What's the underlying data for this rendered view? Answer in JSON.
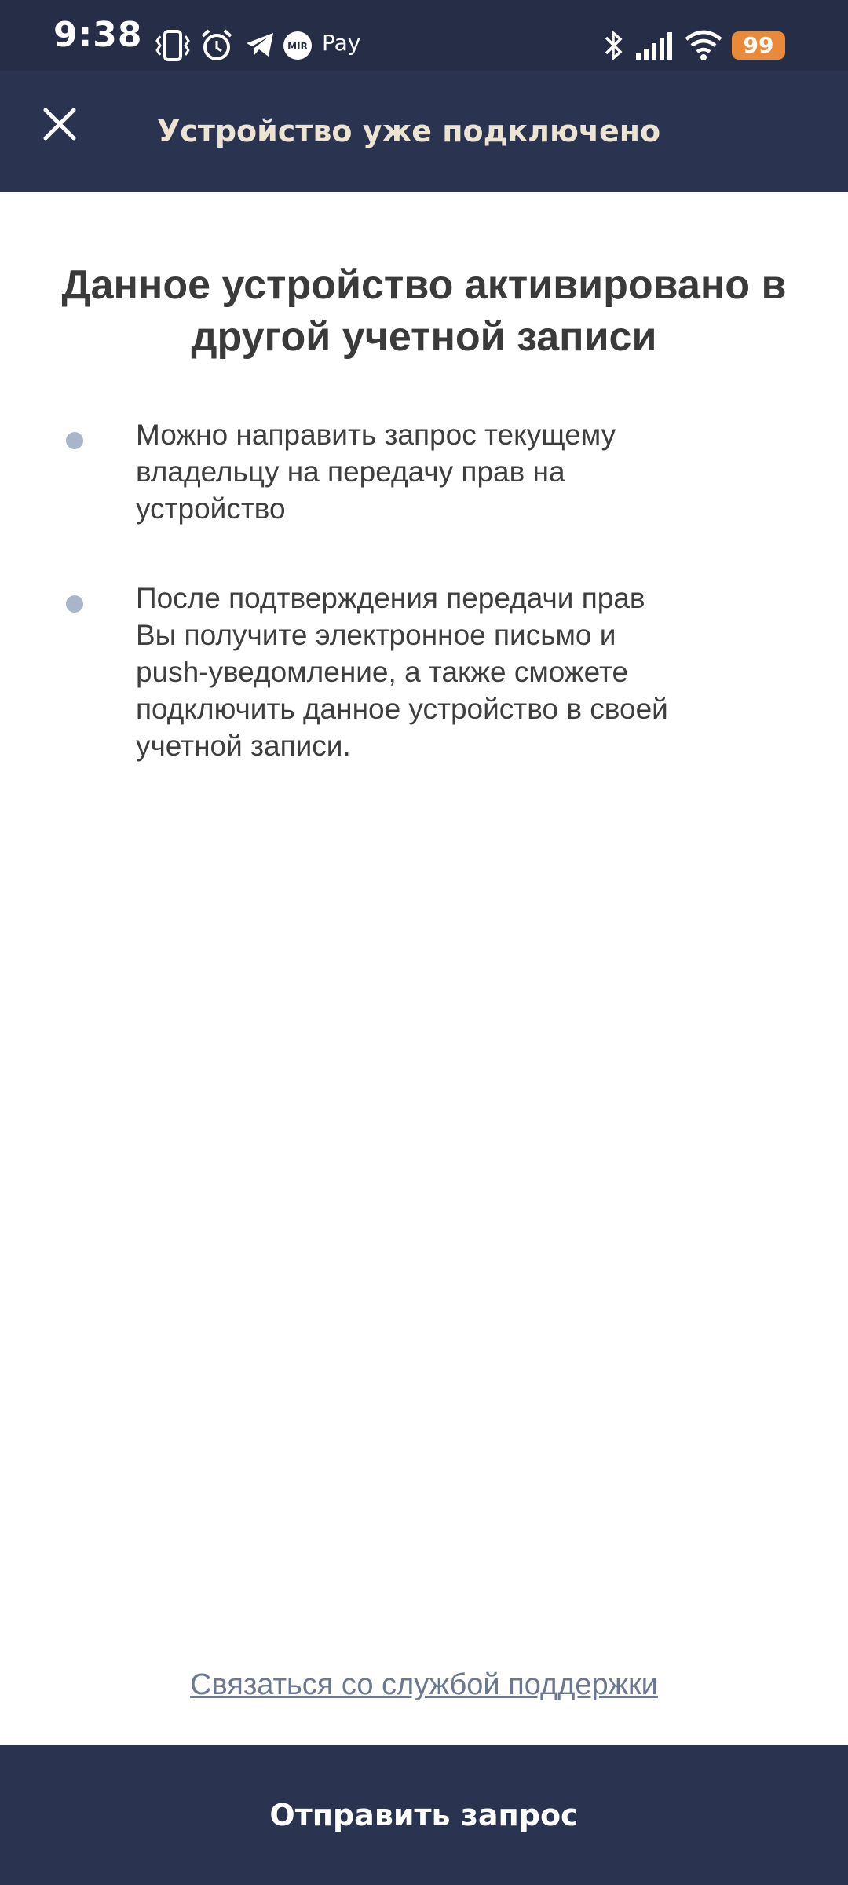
{
  "status_bar": {
    "time": "9:38",
    "pay_label": "Pay",
    "mir_label": "MIR",
    "battery": "99",
    "icons": [
      "vibrate-icon",
      "alarm-icon",
      "telegram-icon",
      "mir-pay-icon",
      "bluetooth-icon",
      "signal-icon",
      "wifi-icon",
      "battery-icon"
    ],
    "colors": {
      "background": "#252d47",
      "battery": "#e88a3a"
    }
  },
  "app_bar": {
    "title": "Устройство уже подключено",
    "close_icon": "close-icon",
    "colors": {
      "background": "#2a3350",
      "title": "#ece3d1"
    }
  },
  "main": {
    "heading": "Данное устройство активировано в другой учетной записи",
    "bullets": [
      {
        "text": "Можно направить запрос текущему\nвладельцу на передачу прав на\nустройство"
      },
      {
        "text": "После подтверждения передачи прав\nВы получите электронное письмо и\npush-уведомление, а также сможете\nподключить данное устройство в своей\nучетной записи."
      }
    ],
    "support_link": "Связаться со службой поддержки"
  },
  "footer": {
    "send_button": "Отправить запрос",
    "colors": {
      "background": "#2a3350"
    }
  }
}
